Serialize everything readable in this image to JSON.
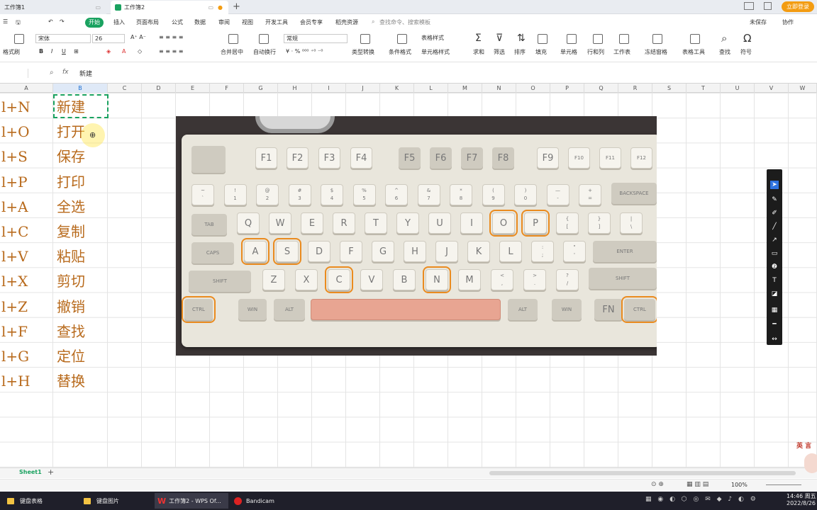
{
  "tabs": [
    {
      "label": "工作簿1",
      "active": false
    },
    {
      "label": "工作簿2",
      "active": true
    }
  ],
  "top_right": {
    "unsaved": "未保存",
    "collab": "协作",
    "login_button": "立即登录"
  },
  "menu": [
    "开始",
    "插入",
    "页面布局",
    "公式",
    "数据",
    "审阅",
    "视图",
    "开发工具",
    "会员专享",
    "稻壳资源"
  ],
  "menu_active": "开始",
  "search_placeholder": "查找命令、搜索模板",
  "ribbon": {
    "format_painter": "格式刷",
    "font_name": "宋体",
    "font_size": "26",
    "merge_center": "合并居中",
    "wrap": "自动换行",
    "number_format": "常规",
    "type_convert": "类型转换",
    "conditional": "条件格式",
    "table_style": "表格样式",
    "cell_style": "单元格样式",
    "sum": "求和",
    "filter": "筛选",
    "sort": "排序",
    "fill": "填充",
    "cell": "单元格",
    "row_col": "行和列",
    "worksheet": "工作表",
    "freeze": "冻结窗格",
    "table_tools": "表格工具",
    "find": "查找",
    "symbol": "符号"
  },
  "formula_bar": {
    "fx": "fx",
    "value": "新建"
  },
  "columns": [
    "A",
    "B",
    "C",
    "D",
    "E",
    "F",
    "G",
    "H",
    "I",
    "J",
    "K",
    "L",
    "M",
    "N",
    "O",
    "P",
    "Q",
    "R",
    "S",
    "T",
    "U",
    "V",
    "W"
  ],
  "rows": [
    {
      "a": "l+N",
      "b": "新建"
    },
    {
      "a": "l+O",
      "b": "打开"
    },
    {
      "a": "l+S",
      "b": "保存"
    },
    {
      "a": "l+P",
      "b": "打印"
    },
    {
      "a": "l+A",
      "b": "全选"
    },
    {
      "a": "l+C",
      "b": "复制"
    },
    {
      "a": "l+V",
      "b": "粘贴"
    },
    {
      "a": "l+X",
      "b": "剪切"
    },
    {
      "a": "l+Z",
      "b": "撤销"
    },
    {
      "a": "l+F",
      "b": "查找"
    },
    {
      "a": "l+G",
      "b": "定位"
    },
    {
      "a": "l+H",
      "b": "替换"
    }
  ],
  "keyboard": {
    "fn_keys": [
      "F1",
      "F2",
      "F3",
      "F4",
      "F5",
      "F6",
      "F7",
      "F8",
      "F9",
      "F10",
      "F11",
      "F12"
    ],
    "num_row": [
      "~\n`",
      "!\n1",
      "@\n2",
      "#\n3",
      "$\n4",
      "%\n5",
      "^\n6",
      "&\n7",
      "*\n8",
      "(\n9",
      ")\n0",
      "—\n-",
      "+\n="
    ],
    "backspace": "BACKSPACE",
    "tab": "TAB",
    "q_row": [
      "Q",
      "W",
      "E",
      "R",
      "T",
      "Y",
      "U",
      "I",
      "O",
      "P",
      "{\n[",
      "}\n]",
      "|\n\\"
    ],
    "caps": "CAPS",
    "a_row": [
      "A",
      "S",
      "D",
      "F",
      "G",
      "H",
      "J",
      "K",
      "L",
      ":\n;",
      "\"\n'"
    ],
    "enter": "ENTER",
    "shift_l": "SHIFT",
    "z_row": [
      "Z",
      "X",
      "C",
      "V",
      "B",
      "N",
      "M",
      "<\n,",
      ">\n.",
      "?\n/"
    ],
    "shift_r": "SHIFT",
    "bottom": [
      "CTRL",
      "WIN",
      "ALT",
      "ALT",
      "WIN",
      "FN",
      "CTRL"
    ],
    "highlighted": [
      "O",
      "P",
      "A",
      "S",
      "C",
      "N",
      "CTRL"
    ]
  },
  "sheet_tab": "Sheet1",
  "zoom": "100%",
  "watermark": "英 言",
  "taskbar": {
    "items": [
      "键盘表格",
      "键盘图片",
      "工作簿2 - WPS Of...",
      "Bandicam"
    ],
    "time": "14:46 周五",
    "date": "2022/8/26"
  },
  "colors": {
    "accent": "#1aa260",
    "cell_text": "#b86a1c",
    "highlight": "#ea8b1f",
    "login": "#f39c12"
  }
}
